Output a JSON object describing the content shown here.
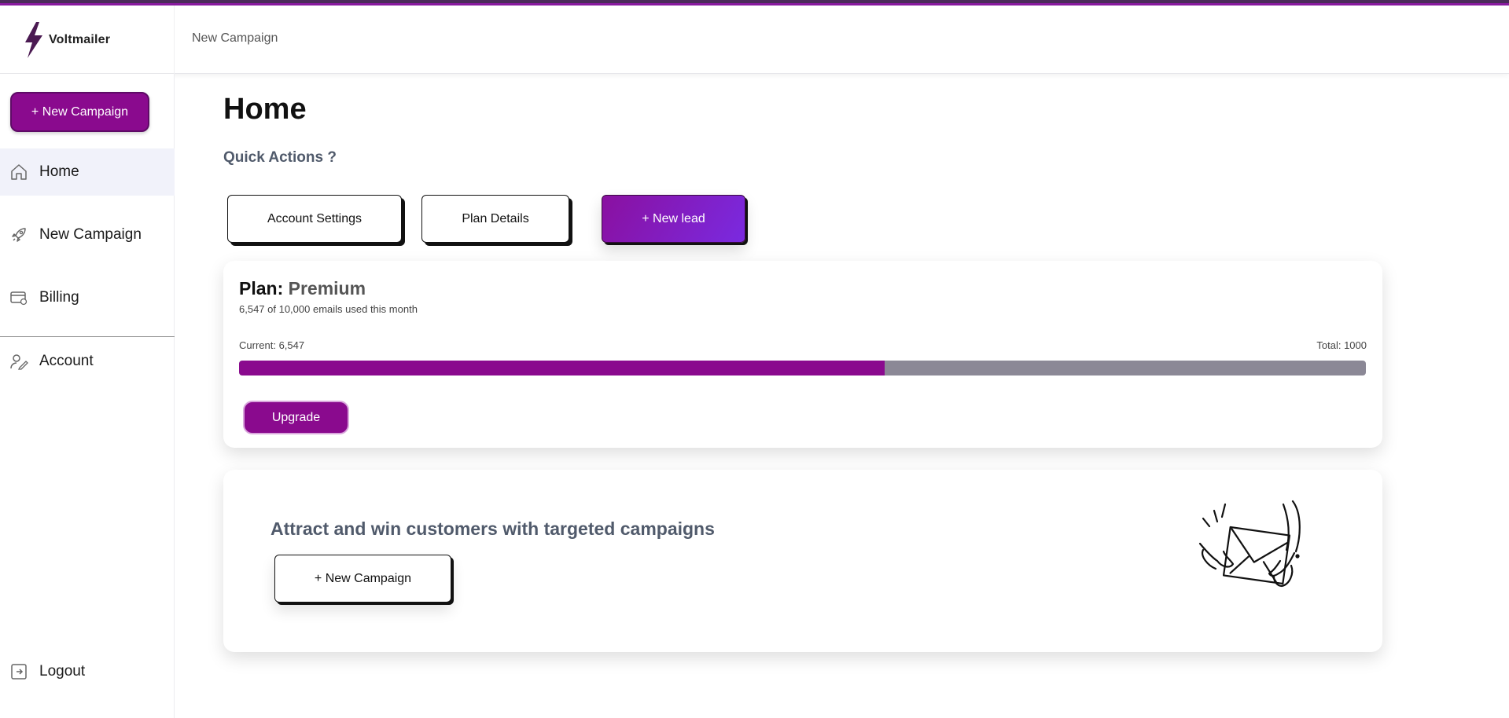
{
  "app": {
    "name": "Voltmailer"
  },
  "header": {
    "breadcrumb": "New Campaign"
  },
  "colors": {
    "brand": "#8a0a8e",
    "accent_top": "#4b2a5a",
    "track": "#8b8896"
  },
  "sidebar": {
    "new_campaign_label": "+ New Campaign",
    "items": [
      {
        "label": "Home",
        "icon": "home-icon",
        "active": true
      },
      {
        "label": "New Campaign",
        "icon": "rocket-icon",
        "active": false
      },
      {
        "label": "Billing",
        "icon": "billing-icon",
        "active": false
      },
      {
        "label": "Account",
        "icon": "account-icon",
        "active": false
      }
    ],
    "logout_label": "Logout"
  },
  "main": {
    "title": "Home",
    "quick_actions_title": "Quick Actions ?",
    "quick_actions": [
      {
        "label": "Account Settings"
      },
      {
        "label": "Plan Details"
      },
      {
        "label": "+ New lead"
      }
    ],
    "plan": {
      "prefix": "Plan:",
      "name": "Premium",
      "usage_text": "6,547 of 10,000 emails used this month",
      "current_label": "Current: 6,547",
      "total_label": "Total: 1000",
      "progress_fraction": 0.573,
      "upgrade_label": "Upgrade"
    },
    "cta": {
      "title": "Attract and win customers with targeted campaigns",
      "button_label": "+ New Campaign",
      "illustration": "envelope-hands-illustration"
    }
  }
}
